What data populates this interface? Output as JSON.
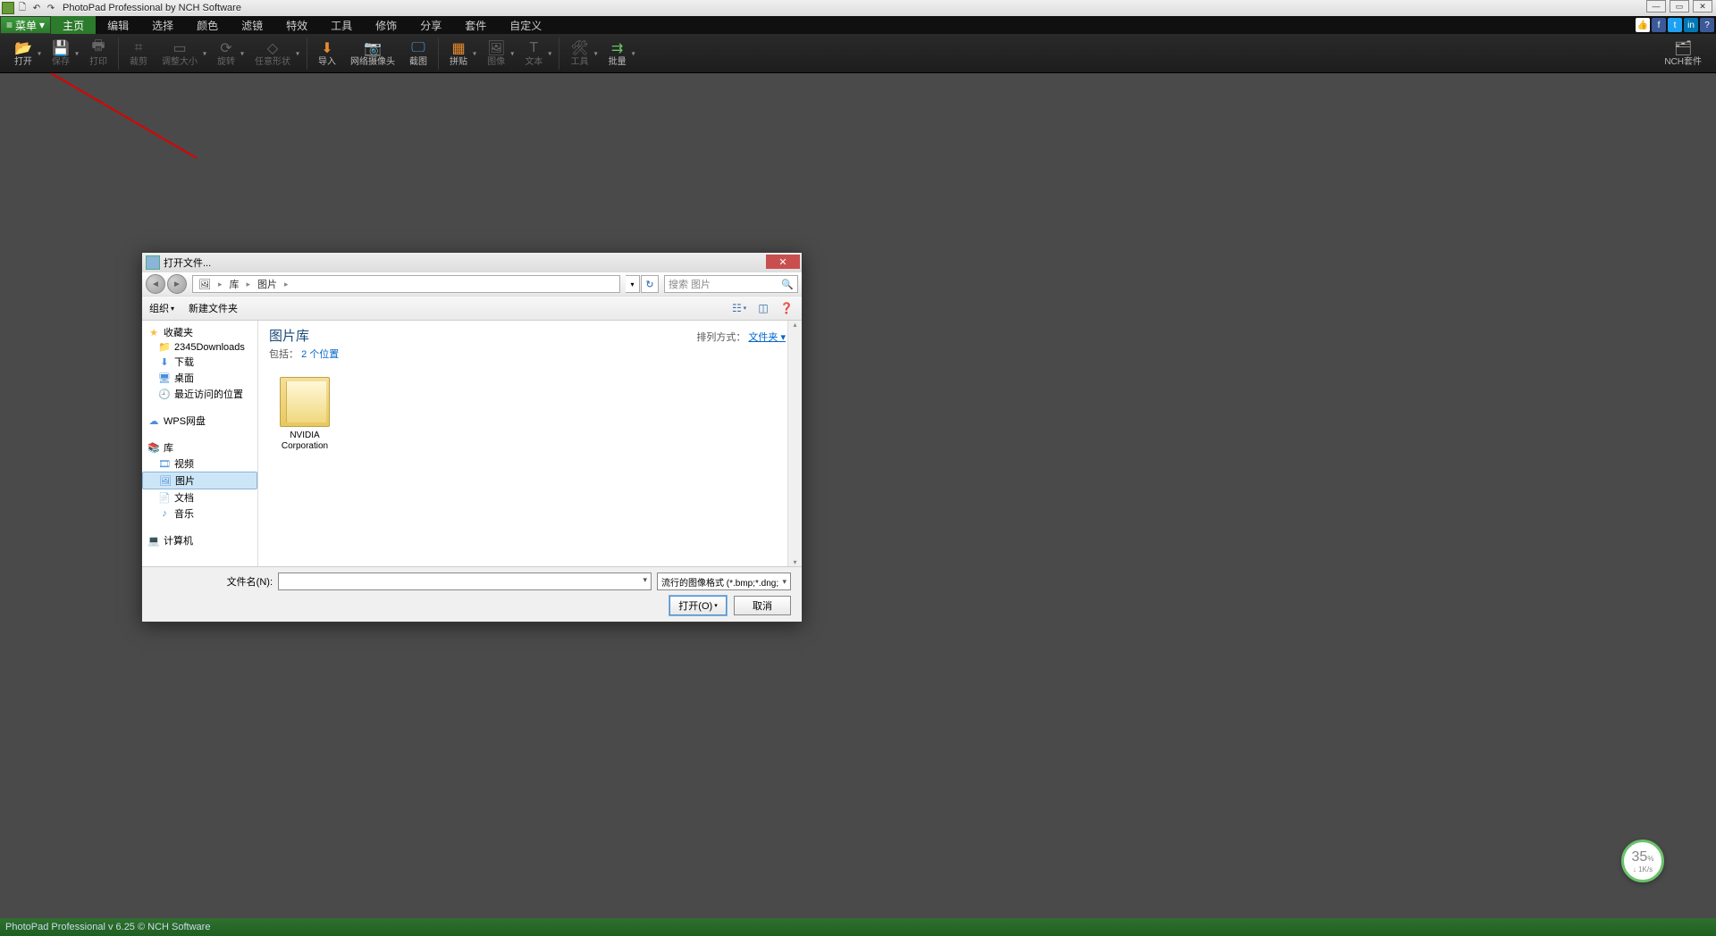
{
  "title_bar": {
    "app_title": "PhotoPad Professional by NCH Software"
  },
  "menu": {
    "menu_button": "菜单",
    "items": [
      "主页",
      "编辑",
      "选择",
      "颜色",
      "滤镜",
      "特效",
      "工具",
      "修饰",
      "分享",
      "套件",
      "自定义"
    ]
  },
  "toolbar": {
    "open": "打开",
    "save": "保存",
    "print": "打印",
    "crop": "裁剪",
    "resize": "调整大小",
    "rotate": "旋转",
    "freeform": "任意形状",
    "import": "导入",
    "webcam": "网络摄像头",
    "screenshot": "截图",
    "collage": "拼贴",
    "image": "图像",
    "text": "文本",
    "tools": "工具",
    "batch": "批量",
    "suite": "NCH套件"
  },
  "dialog": {
    "title": "打开文件...",
    "breadcrumb": [
      "库",
      "图片"
    ],
    "search_placeholder": "搜索 图片",
    "organize": "组织",
    "new_folder": "新建文件夹",
    "sidebar": {
      "favorites": "收藏夹",
      "downloads": "2345Downloads",
      "dl": "下载",
      "desktop": "桌面",
      "recent": "最近访问的位置",
      "wps": "WPS网盘",
      "library": "库",
      "video": "视频",
      "pictures": "图片",
      "documents": "文档",
      "music": "音乐",
      "computer": "计算机"
    },
    "content": {
      "title": "图片库",
      "subtitle_prefix": "包括：",
      "subtitle_link": "2 个位置",
      "sort_label": "排列方式：",
      "sort_value": "文件夹",
      "items": [
        {
          "name": "NVIDIA Corporation"
        }
      ]
    },
    "footer": {
      "filename_label": "文件名(N):",
      "filetype": "流行的图像格式 (*.bmp;*.dng;",
      "open_btn": "打开(O)",
      "cancel_btn": "取消"
    }
  },
  "statusbar": {
    "text": "PhotoPad Professional v 6.25 © NCH Software"
  },
  "speed_widget": {
    "value": "35",
    "unit": "%",
    "rate": "↓ 1K/s"
  }
}
